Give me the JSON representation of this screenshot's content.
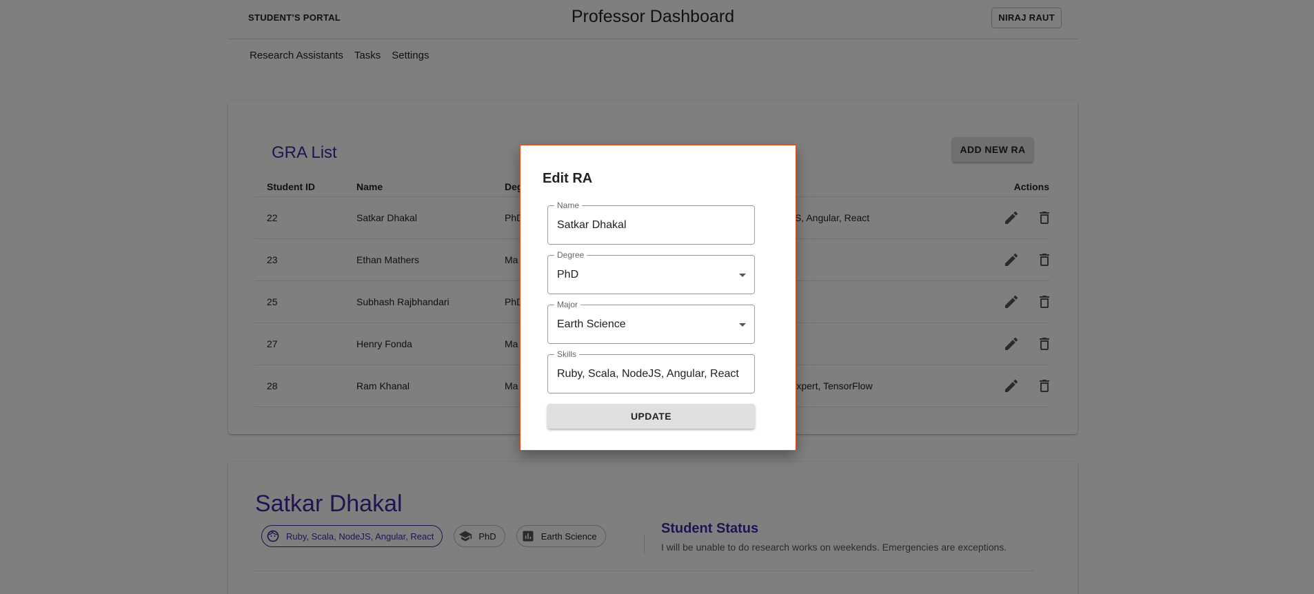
{
  "header": {
    "brand": "STUDENT'S PORTAL",
    "title": "Professor Dashboard",
    "user": "NIRAJ RAUT"
  },
  "nav": {
    "items": [
      "Research Assistants",
      "Tasks",
      "Settings"
    ]
  },
  "gra": {
    "title": "GRA List",
    "add_button": "ADD NEW RA",
    "columns": {
      "id": "Student ID",
      "name": "Name",
      "degree": "Deg",
      "actions": "Actions"
    },
    "rows": [
      {
        "id": "22",
        "name": "Satkar Dhakal",
        "degree": "PhD",
        "skills": "JS, Angular, React"
      },
      {
        "id": "23",
        "name": "Ethan Mathers",
        "degree": "Ma",
        "skills": ""
      },
      {
        "id": "25",
        "name": "Subhash Rajbhandari",
        "degree": "PhD",
        "skills": ""
      },
      {
        "id": "27",
        "name": "Henry Fonda",
        "degree": "Ma",
        "skills": ""
      },
      {
        "id": "28",
        "name": "Ram Khanal",
        "degree": "Ma",
        "skills": "Expert, TensorFlow"
      }
    ]
  },
  "detail": {
    "name": "Satkar Dhakal",
    "chips": {
      "skills": "Ruby, Scala, NodeJS, Angular, React",
      "degree": "PhD",
      "major": "Earth Science"
    },
    "status_title": "Student Status",
    "status_text": "I will be unable to do research works on weekends. Emergencies are exceptions."
  },
  "dialog": {
    "title": "Edit RA",
    "name_label": "Name",
    "name_value": "Satkar Dhakal",
    "degree_label": "Degree",
    "degree_value": "PhD",
    "major_label": "Major",
    "major_value": "Earth Science",
    "skills_label": "Skills",
    "skills_value": "Ruby, Scala, NodeJS, Angular, React",
    "update_button": "UPDATE"
  },
  "colors": {
    "accent": "#4527a0",
    "dialog_border": "#e64a19"
  }
}
